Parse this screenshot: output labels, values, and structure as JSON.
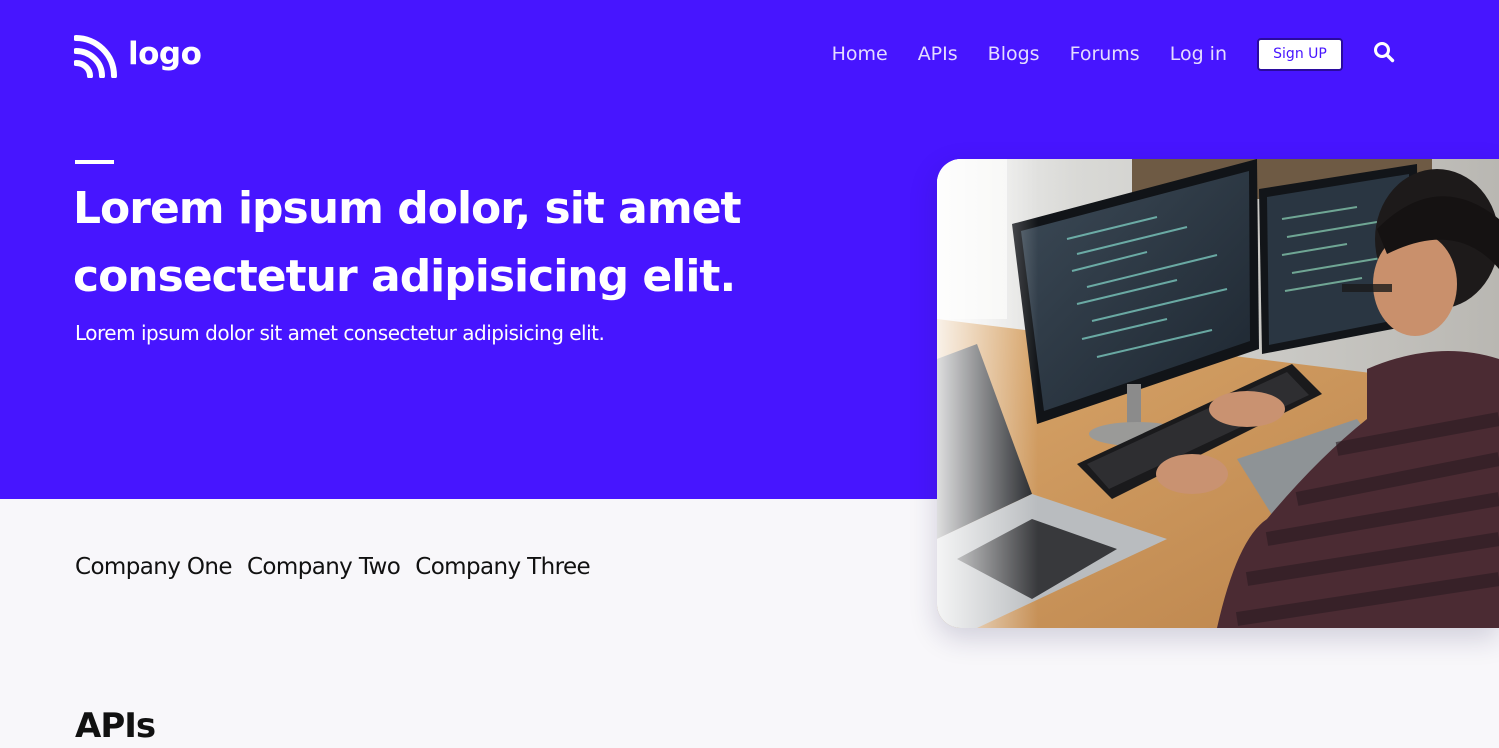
{
  "brand": {
    "logo_text": "logo"
  },
  "nav": {
    "links": [
      "Home",
      "APIs",
      "Blogs",
      "Forums",
      "Log in"
    ],
    "signup_label": "Sign UP"
  },
  "hero": {
    "headline_line1": "Lorem ipsum dolor, sit amet",
    "headline_line2": "consectetur adipisicing elit.",
    "subheading": "Lorem ipsum dolor sit amet consectetur adipisicing elit."
  },
  "companies": [
    "Company One",
    "Company Two",
    "Company Three"
  ],
  "sections": {
    "apis_heading": "APIs"
  },
  "colors": {
    "brand": "#4715ff",
    "page_background": "#f8f7fa",
    "text_dark": "#111111"
  },
  "icons": {
    "logo_mark": "logo-mark-icon",
    "search": "search-icon"
  }
}
